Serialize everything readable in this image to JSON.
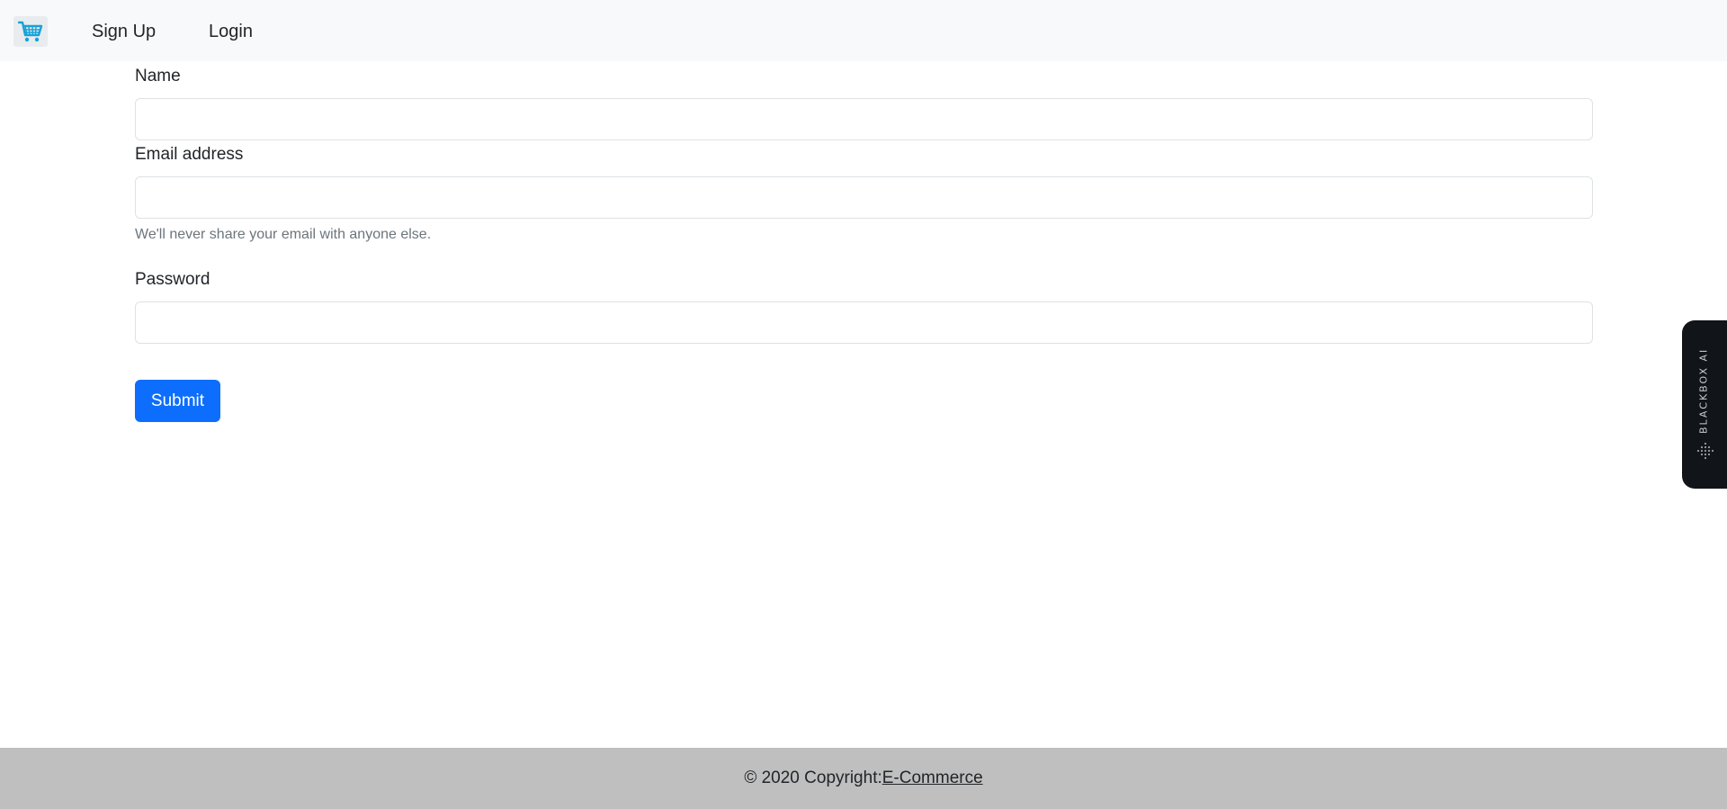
{
  "navbar": {
    "brand_icon": "shopping-cart-icon",
    "brand_color": "#17a2d8",
    "links": [
      {
        "label": "Sign Up"
      },
      {
        "label": "Login"
      }
    ]
  },
  "form": {
    "fields": [
      {
        "label": "Name",
        "value": "",
        "placeholder": ""
      },
      {
        "label": "Email address",
        "value": "",
        "placeholder": "",
        "help": "We'll never share your email with anyone else."
      },
      {
        "label": "Password",
        "value": "",
        "placeholder": ""
      }
    ],
    "submit_label": "Submit",
    "submit_color": "#0d6efd"
  },
  "side_widget": {
    "label": "BLACKBOX AI",
    "icon": "dot-grid-icon"
  },
  "footer": {
    "copyright_text": "© 2020 Copyright:",
    "link_text": "E-Commerce"
  }
}
